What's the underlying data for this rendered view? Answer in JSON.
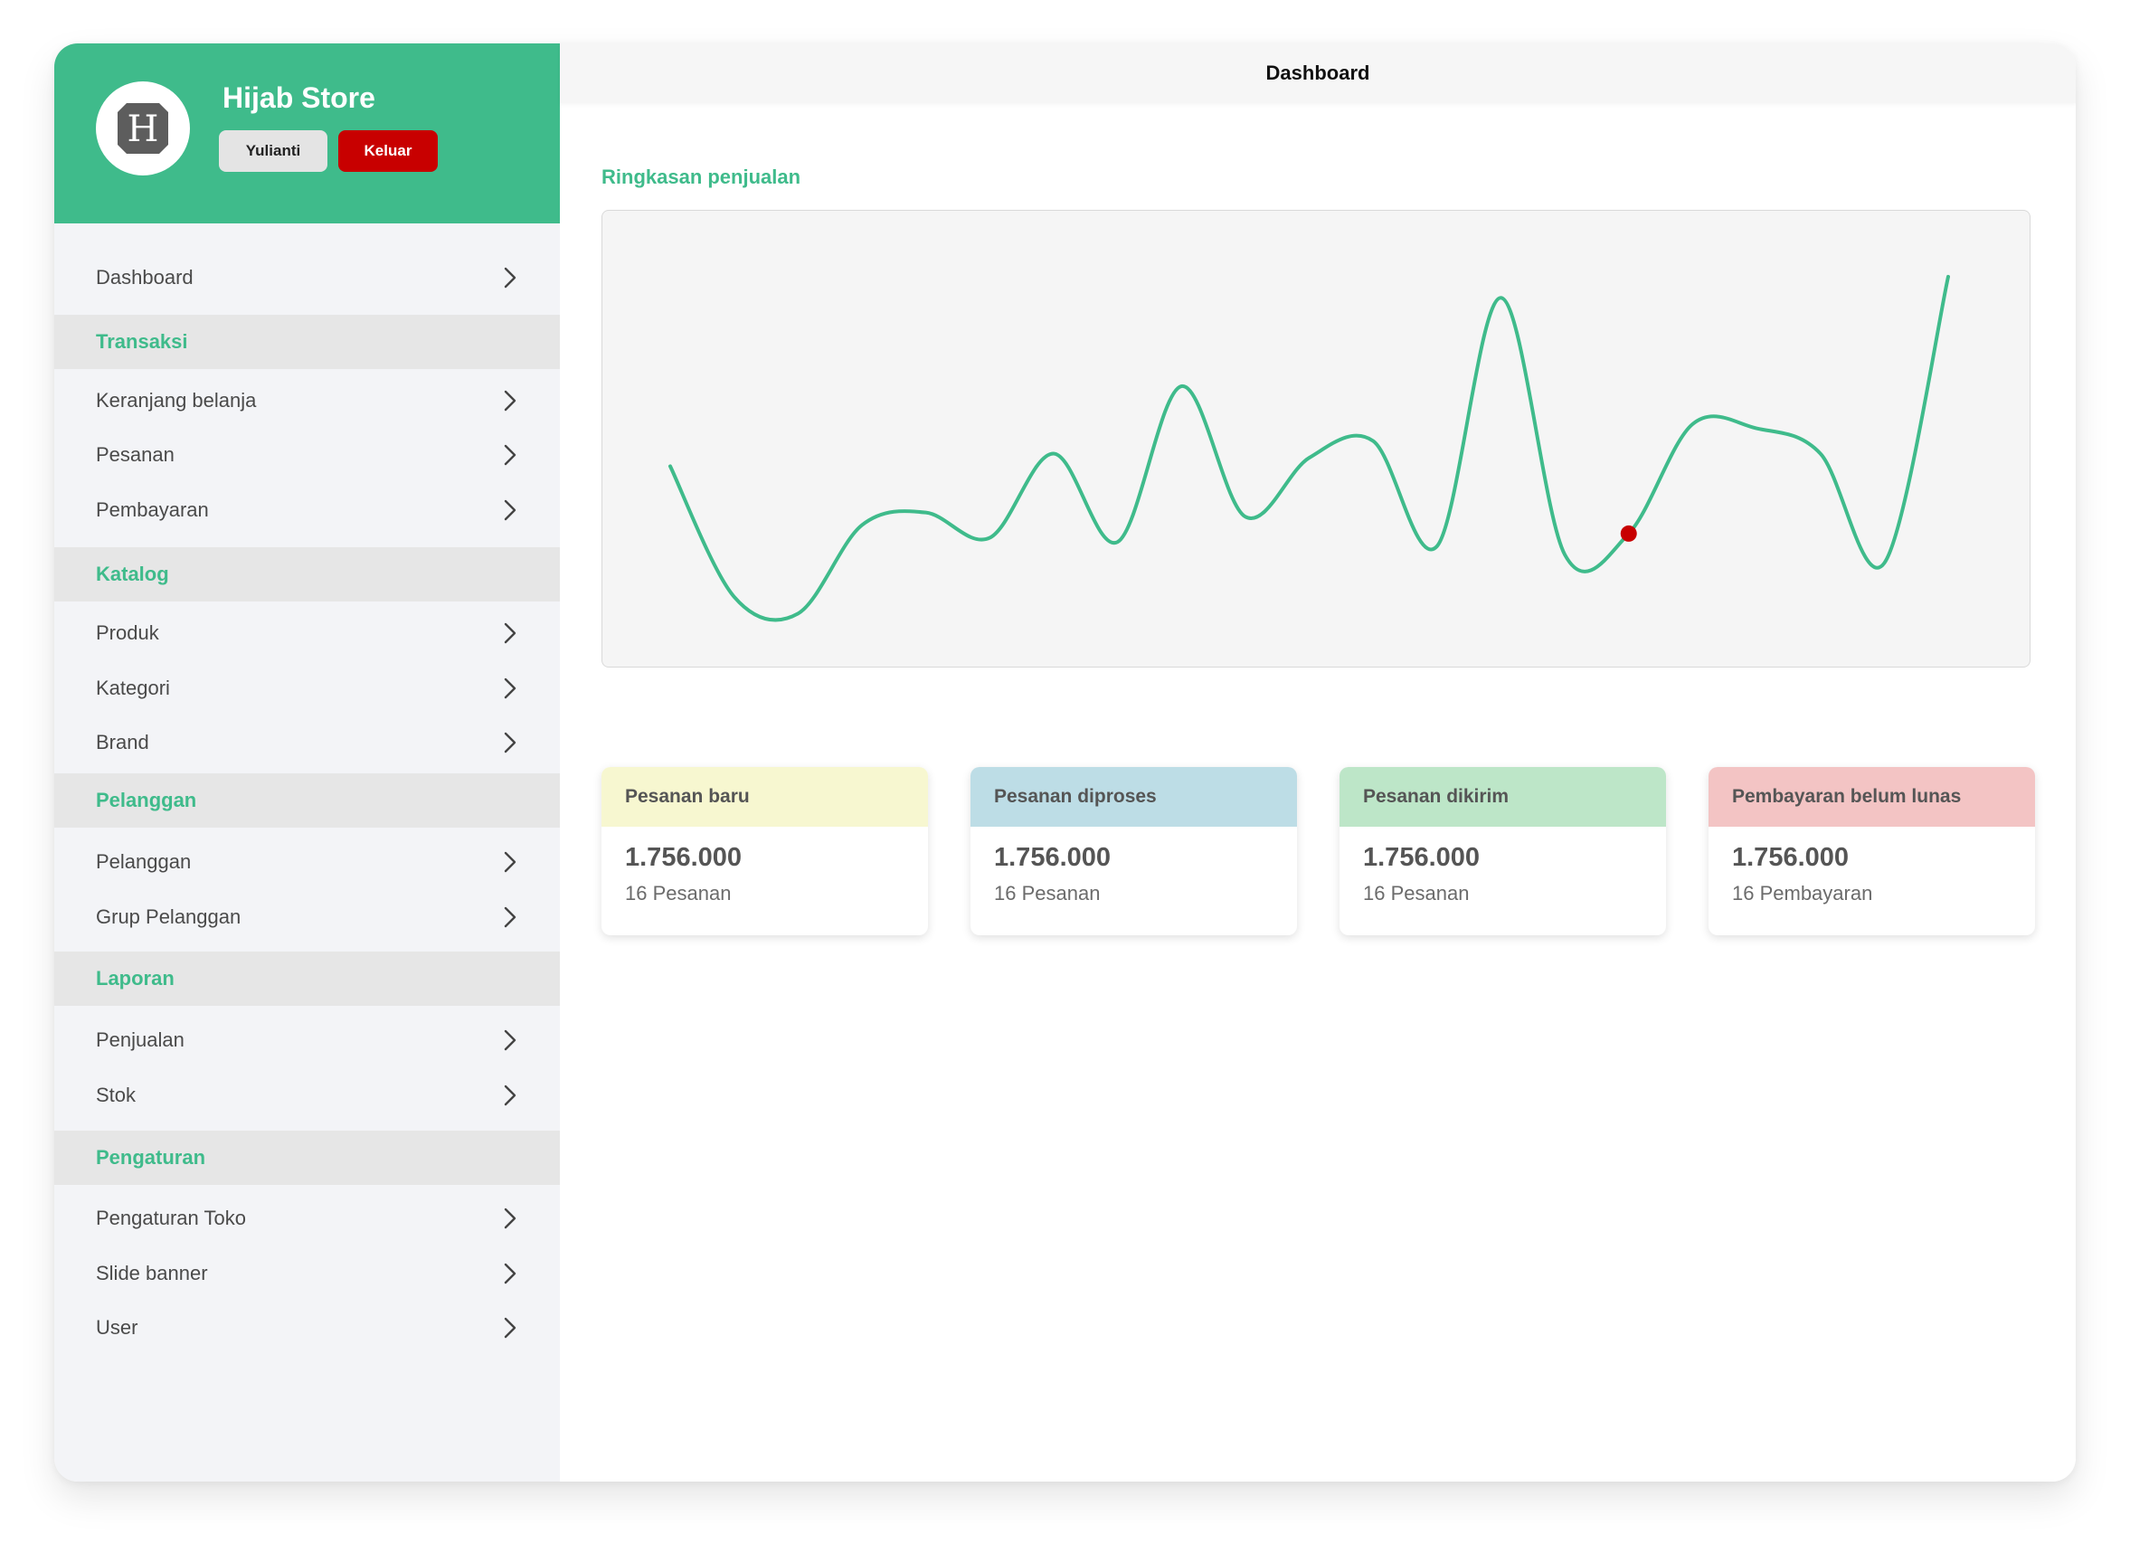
{
  "profile": {
    "store_name": "Hijab Store",
    "user_button": "Yulianti",
    "logout_button": "Keluar",
    "logo_letter": "H"
  },
  "sidebar": {
    "dashboard": "Dashboard",
    "sections": [
      {
        "title": "Transaksi",
        "items": [
          "Keranjang belanja",
          "Pesanan",
          "Pembayaran"
        ]
      },
      {
        "title": "Katalog",
        "items": [
          "Produk",
          "Kategori",
          "Brand"
        ]
      },
      {
        "title": "Pelanggan",
        "items": [
          "Pelanggan",
          "Grup Pelanggan"
        ]
      },
      {
        "title": "Laporan",
        "items": [
          "Penjualan",
          "Stok"
        ]
      },
      {
        "title": "Pengaturan",
        "items": [
          "Pengaturan Toko",
          "Slide banner",
          "User"
        ]
      }
    ]
  },
  "header": {
    "title": "Dashboard"
  },
  "main": {
    "summary_title": "Ringkasan penjualan"
  },
  "chart_data": {
    "type": "line",
    "x": [
      1,
      2,
      3,
      4,
      5,
      6,
      7,
      8,
      9,
      10,
      11,
      12,
      13,
      14,
      15,
      16,
      17,
      18,
      19,
      20,
      21
    ],
    "values": [
      39,
      8,
      4,
      25,
      28,
      22,
      42,
      21,
      58,
      27,
      41,
      45,
      20,
      79,
      18,
      23,
      49,
      48,
      42,
      16,
      84
    ],
    "highlight_index": 15,
    "grid": false,
    "colors": {
      "line": "#3fbb8b",
      "highlight": "#c80000"
    }
  },
  "cards": [
    {
      "title": "Pesanan baru",
      "amount": "1.756.000",
      "sub": "16 Pesanan",
      "color": "#f7f7d0"
    },
    {
      "title": "Pesanan diproses",
      "amount": "1.756.000",
      "sub": "16 Pesanan",
      "color": "#bddde6"
    },
    {
      "title": "Pesanan dikirim",
      "amount": "1.756.000",
      "sub": "16 Pesanan",
      "color": "#bde6c8"
    },
    {
      "title": "Pembayaran belum lunas",
      "amount": "1.756.000",
      "sub": "16 Pembayaran",
      "color": "#f3c4c4"
    }
  ]
}
